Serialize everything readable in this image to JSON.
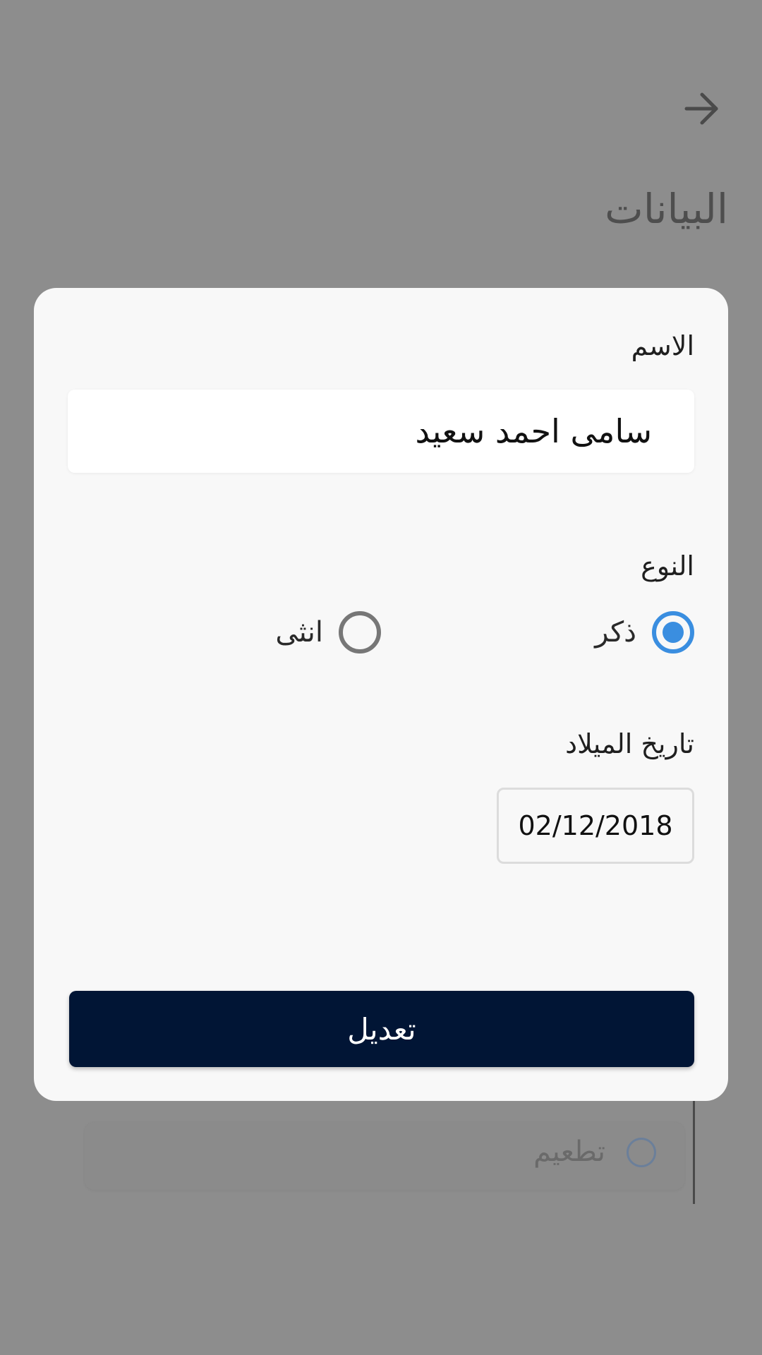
{
  "background": {
    "title": "البيانات",
    "option_label": "تطعيم"
  },
  "modal": {
    "name_label": "الاسم",
    "name_value": "سامى احمد سعيد",
    "gender_label": "النوع",
    "gender_options": [
      {
        "label": "ذكر",
        "selected": true
      },
      {
        "label": "انثى",
        "selected": false
      }
    ],
    "birthdate_label": "تاريخ الميلاد",
    "birthdate_value": "02/12/2018",
    "submit_label": "تعديل"
  },
  "colors": {
    "overlay": "#8d8d8d",
    "modal_bg": "#f8f8f8",
    "accent": "#3a8ee0",
    "button_bg": "#011535"
  }
}
